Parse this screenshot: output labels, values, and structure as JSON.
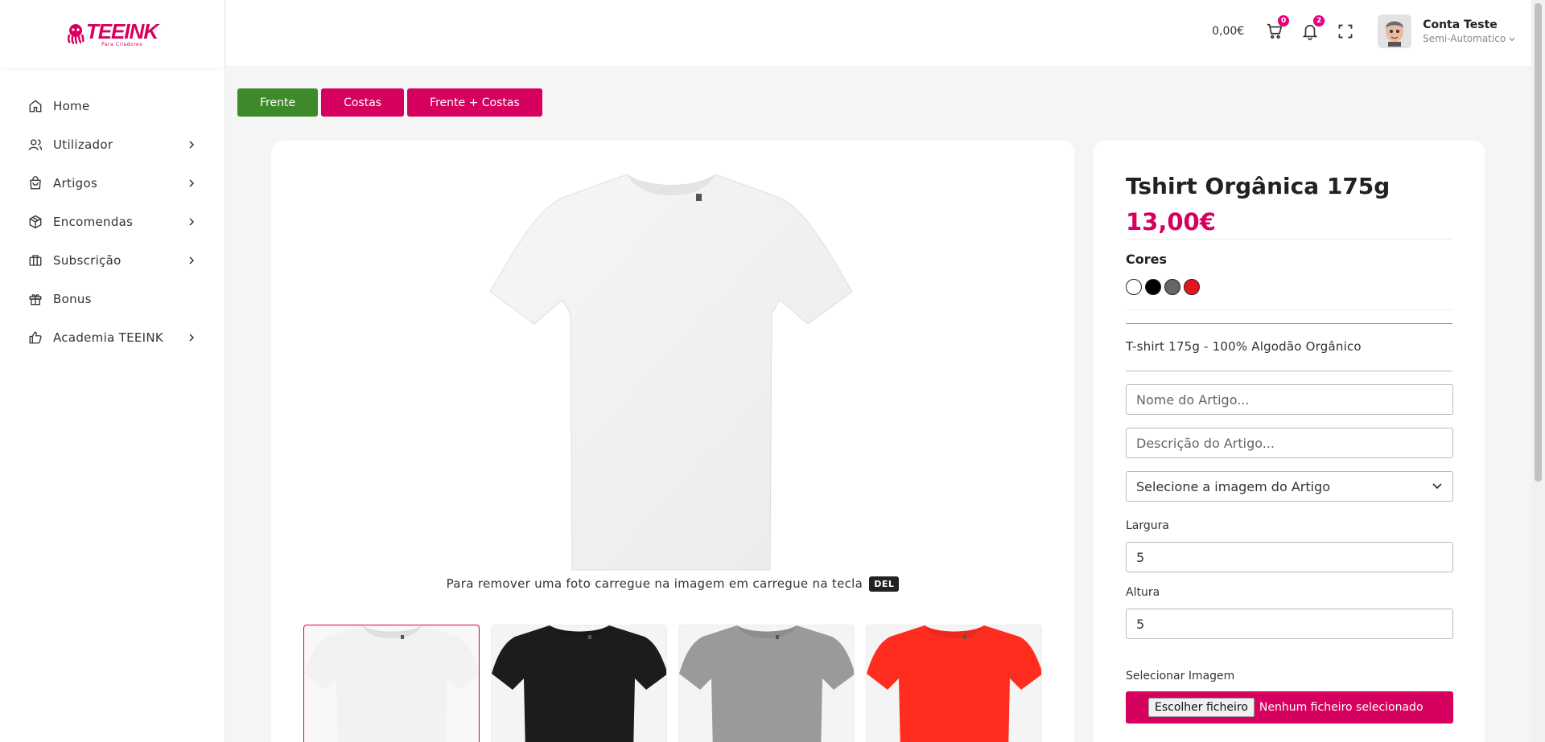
{
  "logo": {
    "text": "TEEINK",
    "subtitle": "Para Criadores"
  },
  "sidebar": {
    "items": [
      {
        "label": "Home",
        "icon": "home-icon",
        "has_submenu": false
      },
      {
        "label": "Utilizador",
        "icon": "users-icon",
        "has_submenu": true
      },
      {
        "label": "Artigos",
        "icon": "shopping-bag-icon",
        "has_submenu": true
      },
      {
        "label": "Encomendas",
        "icon": "package-icon",
        "has_submenu": true
      },
      {
        "label": "Subscrição",
        "icon": "briefcase-icon",
        "has_submenu": true
      },
      {
        "label": "Bonus",
        "icon": "gift-icon",
        "has_submenu": false
      },
      {
        "label": "Academia TEEINK",
        "icon": "thumbs-up-icon",
        "has_submenu": true
      }
    ]
  },
  "header": {
    "balance": "0,00€",
    "cart_count": "0",
    "notification_count": "2",
    "user_name": "Conta Teste",
    "user_role": "Semi-Automatico"
  },
  "view_tabs": {
    "front": "Frente",
    "back": "Costas",
    "front_back": "Frente + Costas"
  },
  "preview": {
    "remove_hint": "Para remover uma foto carregue na imagem em carregue na tecla",
    "key": "DEL",
    "thumbnails": [
      {
        "color": "#f2f2f2",
        "active": true
      },
      {
        "color": "#1c1c1c",
        "active": false
      },
      {
        "color": "#9a9a9a",
        "active": false
      },
      {
        "color": "#ff2d1f",
        "active": false
      }
    ]
  },
  "product": {
    "title": "Tshirt Orgânica 175g",
    "price": "13,00€",
    "colors_label": "Cores",
    "colors": [
      "#ffffff",
      "#000000",
      "#666666",
      "#e8141c"
    ],
    "description": "T-shirt 175g - 100% Algodão Orgânico",
    "name_placeholder": "Nome do Artigo...",
    "desc_placeholder": "Descrição do Artigo...",
    "image_select": "Selecione a imagem do Artigo",
    "width_label": "Largura",
    "width_value": "5",
    "height_label": "Altura",
    "height_value": "5",
    "select_image_label": "Selecionar Imagem",
    "file_button": "Escolher ficheiro",
    "file_status": "Nenhum ficheiro selecionado"
  },
  "colors": {
    "brand": "#d6005e",
    "front_button": "#3e8a2a"
  }
}
